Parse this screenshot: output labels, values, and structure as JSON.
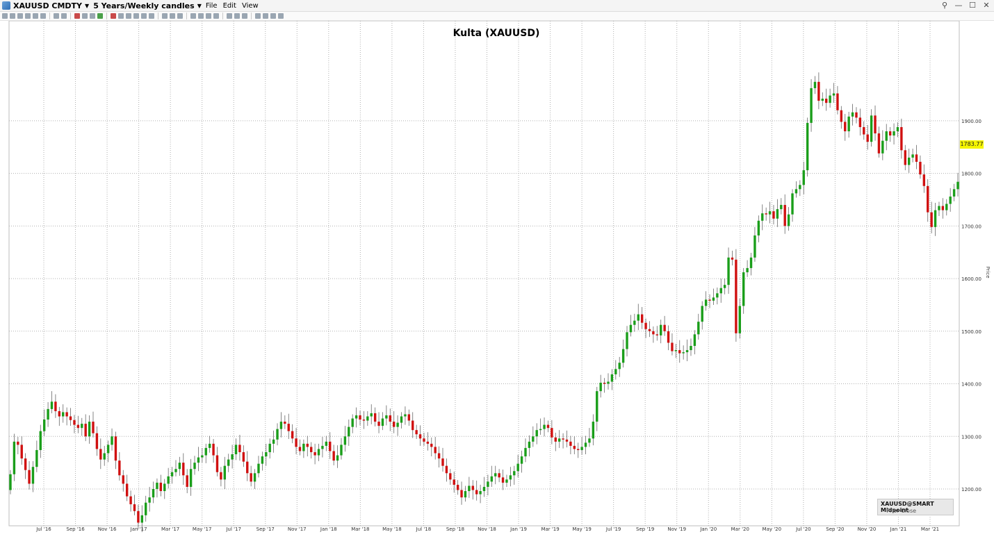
{
  "window": {
    "symbol": "XAUUSD CMDTY",
    "timeframe": "5 Years/Weekly candles",
    "menus": [
      "File",
      "Edit",
      "View"
    ]
  },
  "legend": {
    "title": "XAUUSD@SMART Midpoint",
    "entry": "-- Prior Close"
  },
  "chart_data": {
    "type": "candlestick",
    "title": "Kulta (XAUUSD)",
    "ylabel": "Price",
    "ylim": [
      1130,
      2090
    ],
    "yticks": [
      1200,
      1300,
      1400,
      1500,
      1600,
      1700,
      1800,
      1900
    ],
    "ytick_labels": [
      "1200.00",
      "1300.00",
      "1400.00",
      "1500.00",
      "1600.00",
      "1700.00",
      "1800.00",
      "1900.00"
    ],
    "xticks": [
      "Jul '16",
      "Sep '16",
      "Nov '16",
      "Jan '17",
      "Mar '17",
      "May '17",
      "Jul '17",
      "Sep '17",
      "Nov '17",
      "Jan '18",
      "Mar '18",
      "May '18",
      "Jul '18",
      "Sep '18",
      "Nov '18",
      "Jan '19",
      "Mar '19",
      "May '19",
      "Jul '19",
      "Sep '19",
      "Nov '19",
      "Jan '20",
      "Mar '20",
      "May '20",
      "Jul '20",
      "Sep '20",
      "Nov '20",
      "Jan '21",
      "Mar '21"
    ],
    "last_price": "1783.77",
    "colors": {
      "up": "#1a9e1a",
      "down": "#d01010",
      "grid": "#c8c8c8"
    },
    "closes": [
      1228,
      1290,
      1284,
      1258,
      1236,
      1210,
      1242,
      1274,
      1310,
      1332,
      1352,
      1366,
      1348,
      1338,
      1346,
      1338,
      1331,
      1322,
      1316,
      1324,
      1300,
      1328,
      1306,
      1276,
      1256,
      1268,
      1284,
      1300,
      1254,
      1226,
      1210,
      1186,
      1171,
      1158,
      1136,
      1150,
      1174,
      1184,
      1200,
      1212,
      1196,
      1210,
      1224,
      1232,
      1238,
      1250,
      1226,
      1204,
      1238,
      1250,
      1260,
      1264,
      1278,
      1286,
      1264,
      1232,
      1218,
      1244,
      1256,
      1266,
      1284,
      1270,
      1252,
      1230,
      1214,
      1230,
      1248,
      1262,
      1270,
      1286,
      1294,
      1314,
      1328,
      1324,
      1310,
      1296,
      1280,
      1272,
      1286,
      1280,
      1270,
      1264,
      1276,
      1282,
      1290,
      1272,
      1254,
      1264,
      1284,
      1300,
      1318,
      1334,
      1340,
      1332,
      1330,
      1338,
      1344,
      1328,
      1320,
      1334,
      1340,
      1328,
      1318,
      1326,
      1338,
      1342,
      1330,
      1312,
      1304,
      1296,
      1290,
      1286,
      1280,
      1268,
      1258,
      1244,
      1230,
      1218,
      1208,
      1198,
      1184,
      1196,
      1206,
      1198,
      1190,
      1196,
      1204,
      1214,
      1224,
      1230,
      1222,
      1212,
      1218,
      1226,
      1234,
      1248,
      1262,
      1278,
      1290,
      1300,
      1312,
      1314,
      1322,
      1316,
      1298,
      1290,
      1296,
      1294,
      1290,
      1282,
      1276,
      1274,
      1280,
      1288,
      1296,
      1328,
      1386,
      1402,
      1400,
      1404,
      1418,
      1428,
      1440,
      1466,
      1498,
      1512,
      1520,
      1532,
      1516,
      1504,
      1500,
      1494,
      1492,
      1512,
      1500,
      1478,
      1462,
      1464,
      1458,
      1460,
      1464,
      1472,
      1494,
      1518,
      1548,
      1560,
      1558,
      1564,
      1572,
      1582,
      1588,
      1640,
      1636,
      1496,
      1548,
      1612,
      1620,
      1640,
      1682,
      1710,
      1724,
      1722,
      1728,
      1714,
      1732,
      1740,
      1700,
      1722,
      1762,
      1770,
      1778,
      1806,
      1896,
      1962,
      1974,
      1938,
      1942,
      1934,
      1948,
      1952,
      1920,
      1898,
      1880,
      1908,
      1916,
      1906,
      1888,
      1874,
      1860,
      1910,
      1876,
      1838,
      1862,
      1880,
      1872,
      1880,
      1888,
      1844,
      1816,
      1830,
      1836,
      1822,
      1798,
      1776,
      1726,
      1698,
      1730,
      1738,
      1730,
      1742,
      1756,
      1770,
      1784
    ]
  }
}
